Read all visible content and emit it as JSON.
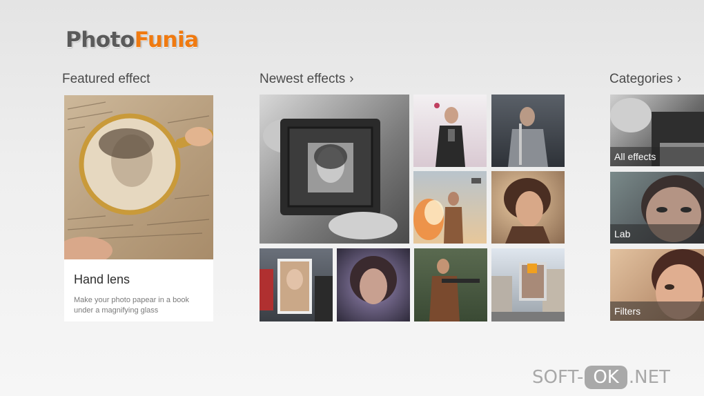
{
  "logo": {
    "part1": "Photo",
    "part2": "Funia",
    "part2_color": "#f07a10"
  },
  "featured": {
    "heading": "Featured effect",
    "title": "Hand lens",
    "description": "Make your photo papear in a book under a magnifying glass"
  },
  "newest": {
    "heading": "Newest effects",
    "chevron": "›"
  },
  "categories": {
    "heading": "Categories",
    "chevron": "›",
    "items": [
      {
        "label": "All effects"
      },
      {
        "label": "Lab"
      },
      {
        "label": "Filters"
      }
    ]
  },
  "watermark": {
    "left": "SOFT-",
    "pill": "OK",
    "right": ".NET"
  }
}
